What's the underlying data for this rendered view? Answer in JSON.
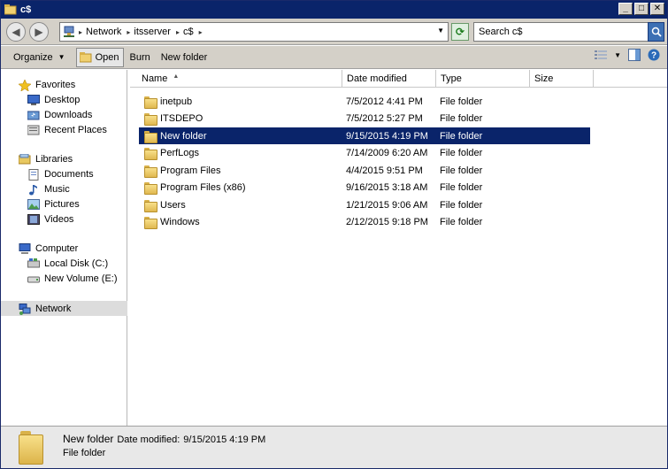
{
  "window": {
    "title": "c$"
  },
  "address": {
    "crumbs": [
      "Network",
      "itsserver",
      "c$"
    ]
  },
  "search": {
    "placeholder": "Search c$"
  },
  "toolbar": {
    "organize_label": "Organize",
    "open_label": "Open",
    "burn_label": "Burn",
    "new_folder_label": "New folder"
  },
  "navpane": {
    "favorites": {
      "label": "Favorites",
      "items": [
        "Desktop",
        "Downloads",
        "Recent Places"
      ]
    },
    "libraries": {
      "label": "Libraries",
      "items": [
        "Documents",
        "Music",
        "Pictures",
        "Videos"
      ]
    },
    "computer": {
      "label": "Computer",
      "items": [
        "Local Disk (C:)",
        "New Volume (E:)"
      ]
    },
    "network": {
      "label": "Network"
    }
  },
  "columns": {
    "name": "Name",
    "date": "Date modified",
    "type": "Type",
    "size": "Size"
  },
  "files": [
    {
      "name": "inetpub",
      "date": "7/5/2012 4:41 PM",
      "type": "File folder"
    },
    {
      "name": "ITSDEPO",
      "date": "7/5/2012 5:27 PM",
      "type": "File folder"
    },
    {
      "name": "New folder",
      "date": "9/15/2015 4:19 PM",
      "type": "File folder",
      "selected": true
    },
    {
      "name": "PerfLogs",
      "date": "7/14/2009 6:20 AM",
      "type": "File folder"
    },
    {
      "name": "Program Files",
      "date": "4/4/2015 9:51 PM",
      "type": "File folder"
    },
    {
      "name": "Program Files (x86)",
      "date": "9/16/2015 3:18 AM",
      "type": "File folder"
    },
    {
      "name": "Users",
      "date": "1/21/2015 9:06 AM",
      "type": "File folder"
    },
    {
      "name": "Windows",
      "date": "2/12/2015 9:18 PM",
      "type": "File folder"
    }
  ],
  "details": {
    "name": "New folder",
    "date_label": "Date modified:",
    "date_value": "9/15/2015 4:19 PM",
    "type": "File folder"
  }
}
